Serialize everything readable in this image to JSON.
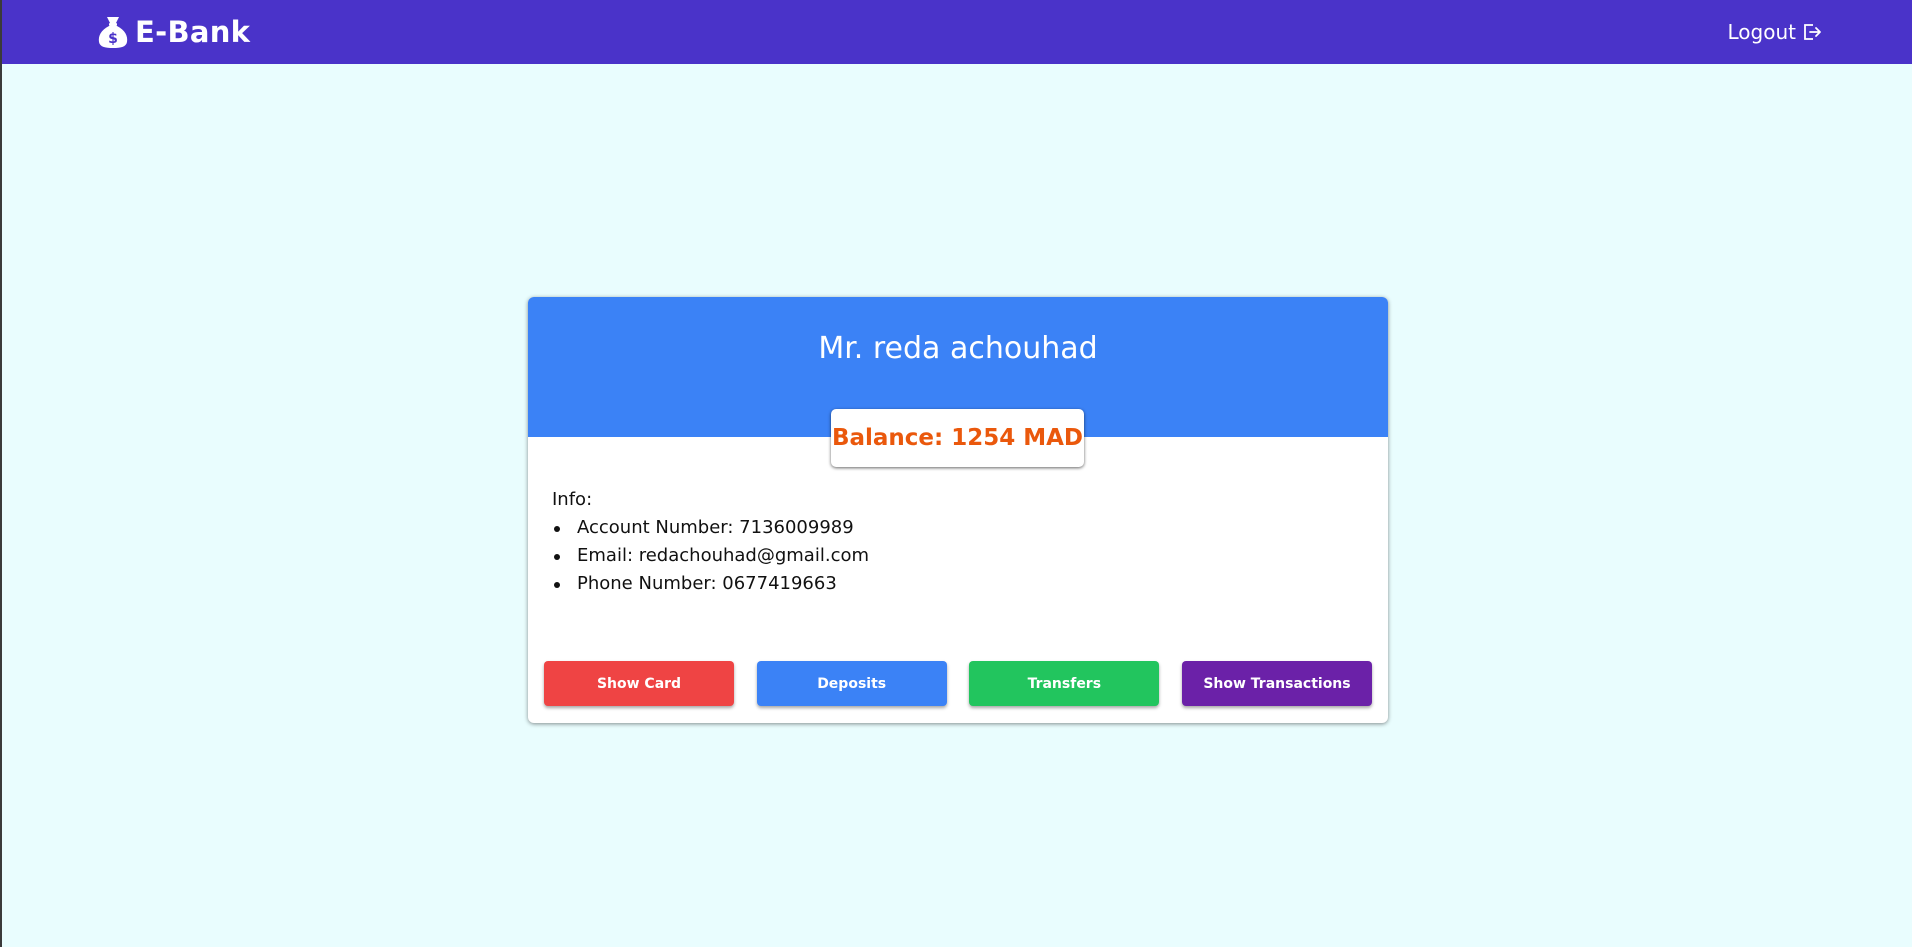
{
  "nav": {
    "brand": "E-Bank",
    "brand_icon": "money-bag-icon",
    "logout_label": "Logout",
    "logout_icon": "logout-icon"
  },
  "account": {
    "name": "Mr. reda achouhad",
    "balance_label": "Balance: 1254 MAD",
    "info_heading": "Info:",
    "details": [
      "Account Number: 7136009989",
      "Email: redachouhad@gmail.com",
      "Phone Number: 0677419663"
    ]
  },
  "actions": {
    "show_card": "Show Card",
    "deposits": "Deposits",
    "transfers": "Transfers",
    "show_transactions": "Show Transactions"
  },
  "colors": {
    "navbar": "#4a33c9",
    "background": "#e9fdfe",
    "card_header": "#3b82f6",
    "balance_text": "#ea580c",
    "show_card_button": "#ef4444",
    "deposits_button": "#3b82f6",
    "transfers_button": "#22c55e",
    "show_transactions_button": "#6b21a8"
  }
}
